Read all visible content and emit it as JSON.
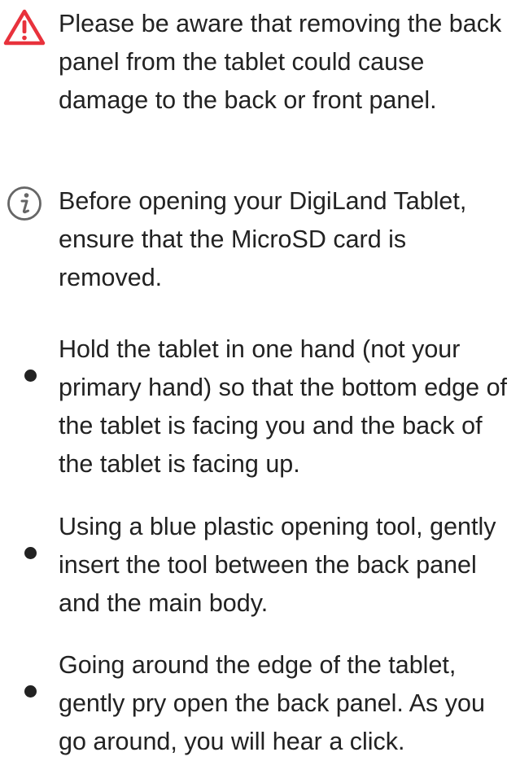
{
  "items": [
    {
      "kind": "warning",
      "icon": "warning-triangle-icon",
      "text": "Please be aware that removing the back panel from the tablet could cause damage to the back or front panel."
    },
    {
      "kind": "note",
      "icon": "info-circle-icon",
      "text": "Before opening your DigiLand Tablet, ensure that the MicroSD card is removed."
    },
    {
      "kind": "bullet",
      "icon": "bullet-icon",
      "text": "Hold the tablet in one hand (not your primary hand) so that the bottom edge of the tablet is facing you and the back of the tablet is facing up."
    },
    {
      "kind": "bullet",
      "icon": "bullet-icon",
      "text": "Using a blue plastic opening tool, gently insert the tool between the back panel and the main body."
    },
    {
      "kind": "bullet",
      "icon": "bullet-icon",
      "text": "Going around the edge of the tablet, gently pry open the back panel. As you go around, you will hear a click."
    }
  ],
  "colors": {
    "warning": "#e8323c",
    "info": "#666666",
    "text": "#222222"
  }
}
